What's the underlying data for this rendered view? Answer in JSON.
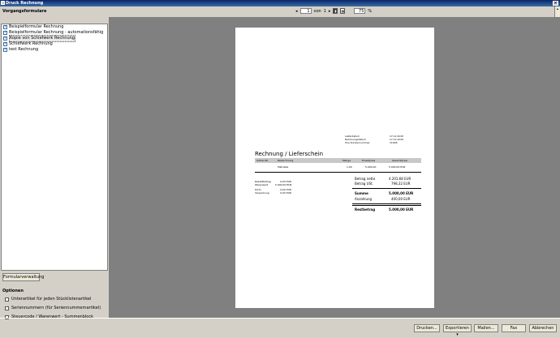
{
  "window": {
    "title": "Druck Rechnung"
  },
  "left": {
    "heading": "Vorgangsformulare",
    "forms": [
      {
        "label": "Beispielformular Rechnung"
      },
      {
        "label": "Beispielformular Rechnung - automationsfähig"
      },
      {
        "label": "Kopie von Schiefwerk Rechnung"
      },
      {
        "label": "Schiefwerk Rechnung"
      },
      {
        "label": "test Rechnung"
      }
    ],
    "manage_button": "Formularverwaltung",
    "options_heading": "Optionen",
    "options": [
      {
        "label": "Unterartikel für jeden Stücklistenartikel"
      },
      {
        "label": "Seriennummern (für Seriennummernartikel)"
      },
      {
        "label": "Steuercode / Warenwert - Summenblock"
      }
    ]
  },
  "toolbar": {
    "page_current": "1",
    "page_von": "von",
    "page_total": "1",
    "zoom": "75",
    "zoom_unit": "%"
  },
  "document": {
    "meta_labels": [
      "Lieferdatum",
      "Rechnungsdatum",
      "Ihre Kundennummer"
    ],
    "meta_values": [
      "17.12.2015",
      "17.12.2015",
      "11626"
    ],
    "title": "Rechnung / Lieferschein",
    "columns": [
      "Artikel-Nr.",
      "Bezeichnung",
      "Menge",
      "Einzelpreis",
      "Gesamtpreis"
    ],
    "row": {
      "artikel": "",
      "bezeichnung": "Matratze",
      "menge": "1,00",
      "einzel": "5.000,00",
      "gesamt": "5.000,00 EUR"
    },
    "left_labels": [
      "Rabattbetrag",
      "Warenwert",
      "Porto",
      "Verpackung"
    ],
    "left_values": [
      "0,00 EUR",
      "5.000,00 EUR",
      "0,00 EUR",
      "0,00 EUR"
    ],
    "totals": [
      {
        "label": "Betrag netto",
        "value": "4.201,68 EUR"
      },
      {
        "label": "Betrag USt.",
        "value": "798,32 EUR"
      },
      {
        "label": "Summe",
        "value": "5.000,00 EUR"
      },
      {
        "label": "Anzahlung",
        "value": "400,00 EUR"
      },
      {
        "label": "Restbetrag",
        "value": "5.000,00 EUR"
      }
    ]
  },
  "buttons": {
    "drucken": "Drucken...",
    "exportieren": "Exportieren",
    "mailen": "Mailen...",
    "fax": "Fax",
    "abbrechen": "Abbrechen"
  }
}
